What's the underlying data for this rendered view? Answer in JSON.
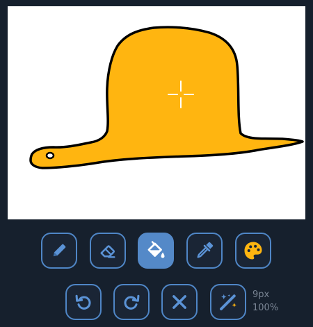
{
  "canvas": {
    "background": "#ffffff",
    "fill_color": "#ffb510",
    "outline_color": "#000000",
    "cursor": "crosshair-icon"
  },
  "toolbar": {
    "row1": [
      {
        "name": "pencil",
        "icon": "pencil-icon",
        "active": false
      },
      {
        "name": "eraser",
        "icon": "eraser-icon",
        "active": false
      },
      {
        "name": "fill",
        "icon": "paint-bucket-icon",
        "active": true
      },
      {
        "name": "eyedropper",
        "icon": "eyedropper-icon",
        "active": false
      },
      {
        "name": "palette",
        "icon": "palette-icon",
        "active": false,
        "color": "#ffb510"
      }
    ],
    "row2": [
      {
        "name": "undo",
        "icon": "undo-icon"
      },
      {
        "name": "redo",
        "icon": "redo-icon"
      },
      {
        "name": "clear",
        "icon": "close-icon"
      },
      {
        "name": "magic",
        "icon": "magic-wand-icon"
      }
    ],
    "accent": "#4f86c6"
  },
  "status": {
    "brush_size": "9px",
    "zoom": "100%"
  }
}
